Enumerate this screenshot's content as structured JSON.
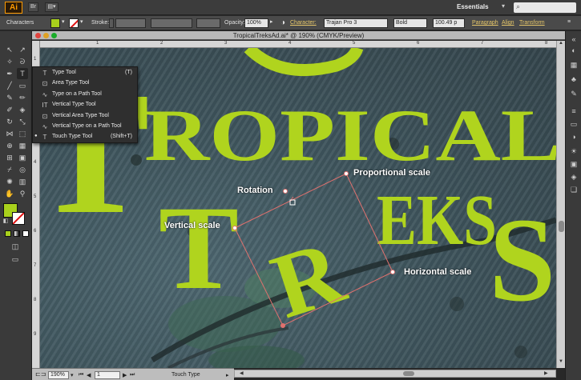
{
  "app": {
    "logo": "Ai",
    "workspace": "Essentials",
    "bridge_icon": "bridge-icon",
    "arrange_icon": "arrange-documents-icon"
  },
  "control_bar": {
    "panel_label": "Characters",
    "stroke_label": "Stroke:",
    "opacity_label": "Opacity:",
    "opacity_value": "100%",
    "character_label": "Character:",
    "font_family": "Trajan Pro 3",
    "font_style": "Bold",
    "font_size": "100.49 p",
    "paragraph_link": "Paragraph",
    "align_link": "Align",
    "transform_link": "Transform",
    "fill_color": "#a9d11c"
  },
  "document": {
    "title": "TropicalTreksAd.ai* @ 190% (CMYK/Preview)",
    "ruler_top": [
      "1",
      "2",
      "3",
      "4",
      "5",
      "6",
      "7",
      "8"
    ],
    "ruler_left": [
      "1",
      "2",
      "3",
      "4",
      "5",
      "6",
      "7",
      "8",
      "9"
    ]
  },
  "artwork": {
    "letter_big_t": "T",
    "line1": "ROPICAL",
    "big_t2": "T",
    "big_r": "R",
    "line2": "EKS",
    "tail_s": "S",
    "ink_color": "#b0d41e"
  },
  "flyout": {
    "items": [
      {
        "icon": "type-tool-icon",
        "glyph": "T",
        "label": "Type Tool",
        "shortcut": "(T)",
        "checked": false
      },
      {
        "icon": "area-type-tool-icon",
        "glyph": "⊡",
        "label": "Area Type Tool",
        "shortcut": "",
        "checked": false
      },
      {
        "icon": "type-on-path-tool-icon",
        "glyph": "∿",
        "label": "Type on a Path Tool",
        "shortcut": "",
        "checked": false
      },
      {
        "icon": "vertical-type-tool-icon",
        "glyph": "ⅠT",
        "label": "Vertical Type Tool",
        "shortcut": "",
        "checked": false
      },
      {
        "icon": "vertical-area-type-tool-icon",
        "glyph": "⊡",
        "label": "Vertical Area Type Tool",
        "shortcut": "",
        "checked": false
      },
      {
        "icon": "vertical-type-on-path-tool-icon",
        "glyph": "∿",
        "label": "Vertical Type on a Path Tool",
        "shortcut": "",
        "checked": false
      },
      {
        "icon": "touch-type-tool-icon",
        "glyph": "T",
        "label": "Touch Type Tool",
        "shortcut": "(Shift+T)",
        "checked": true
      }
    ]
  },
  "annotations": {
    "proportional": "Proportional scale",
    "rotation": "Rotation",
    "vertical": "Vertical scale",
    "horizontal": "Horizontal scale"
  },
  "status_bar": {
    "zoom": "190%",
    "artboard": "1",
    "current_tool": "Touch Type"
  }
}
